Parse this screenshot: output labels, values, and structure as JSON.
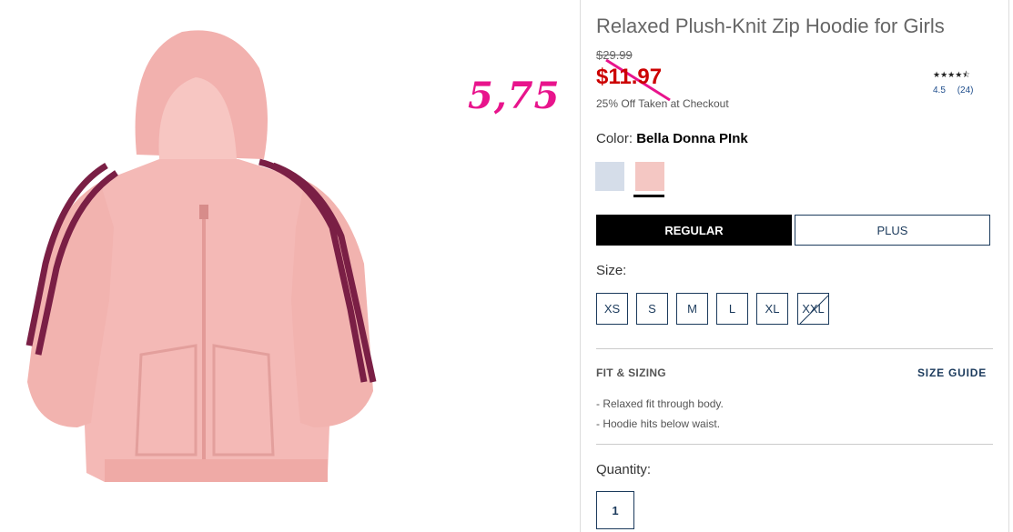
{
  "product": {
    "title": "Relaxed Plush-Knit Zip Hoodie for Girls",
    "original_price": "$29.99",
    "sale_price": "$11.97",
    "promo": "25% Off Taken at Checkout",
    "image_alt_icon": "pink-zip-hoodie-image"
  },
  "annotation": {
    "handwritten_price": "5,75",
    "color": "#e8148c"
  },
  "rating": {
    "stars": "★★★★⯪",
    "value": 4.5,
    "score_label": "4.5",
    "count_label": "(24)"
  },
  "color": {
    "label": "Color:",
    "selected": "Bella Donna PInk",
    "swatches": [
      {
        "name": "light-blue",
        "hex": "#d5dde9"
      },
      {
        "name": "pink",
        "hex": "#f4c7c3",
        "selected": true
      }
    ]
  },
  "fit": {
    "options": [
      "REGULAR",
      "PLUS"
    ],
    "selected": "REGULAR"
  },
  "size": {
    "label": "Size:",
    "options": [
      "XS",
      "S",
      "M",
      "L",
      "XL",
      "XXL"
    ],
    "unavailable": [
      "XXL"
    ]
  },
  "fit_sizing": {
    "heading": "FIT & SIZING",
    "guide_link": "SIZE GUIDE",
    "bullets": [
      "-  Relaxed fit through body.",
      "-  Hoodie hits below waist."
    ]
  },
  "quantity": {
    "label": "Quantity:",
    "value": "1"
  },
  "colors": {
    "sale": "#cc0000",
    "navy": "#1b3a5c",
    "black": "#000000"
  }
}
